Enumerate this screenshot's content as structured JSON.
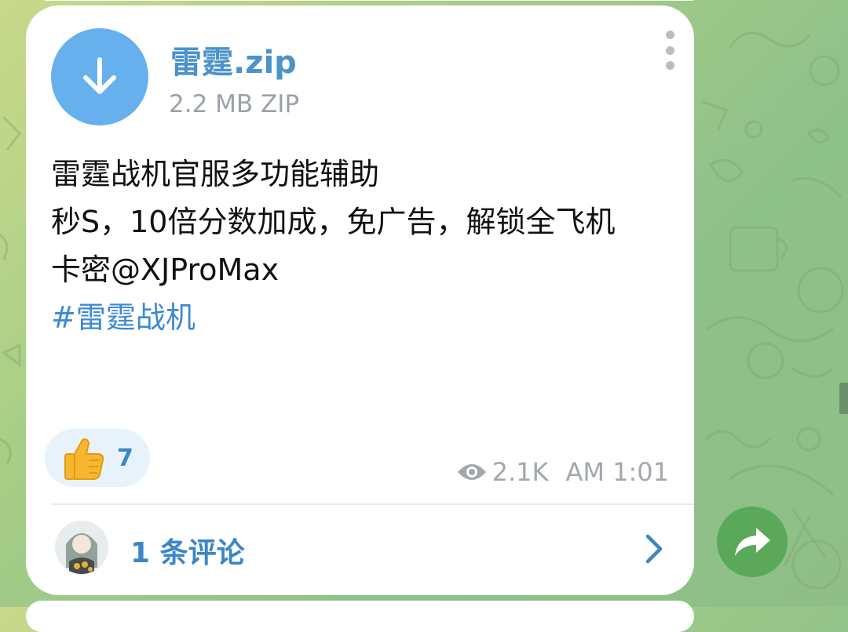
{
  "colors": {
    "accent": "#4b93c9",
    "link": "#3d8ad2",
    "file_icon_bg": "#67b0ee",
    "share_button_bg": "#5aa85a",
    "meta_gray": "#a2a8ad"
  },
  "file": {
    "name": "雷霆.zip",
    "meta": "2.2 MB ZIP",
    "icon": "download-arrow-icon"
  },
  "message": {
    "lines": [
      "雷霆战机官服多功能辅助",
      "秒S，10倍分数加成，免广告，解锁全飞机",
      "卡密@XJProMax"
    ],
    "hashtag": "#雷霆战机"
  },
  "reaction": {
    "emoji": "thumbs-up-icon",
    "count": "7"
  },
  "meta": {
    "views_icon": "eye-icon",
    "views": "2.1K",
    "time": "AM 1:01"
  },
  "comments": {
    "label": "1 条评论",
    "avatar": "commenter-avatar",
    "chevron": "chevron-right-icon"
  },
  "share": {
    "icon": "share-arrow-icon"
  }
}
